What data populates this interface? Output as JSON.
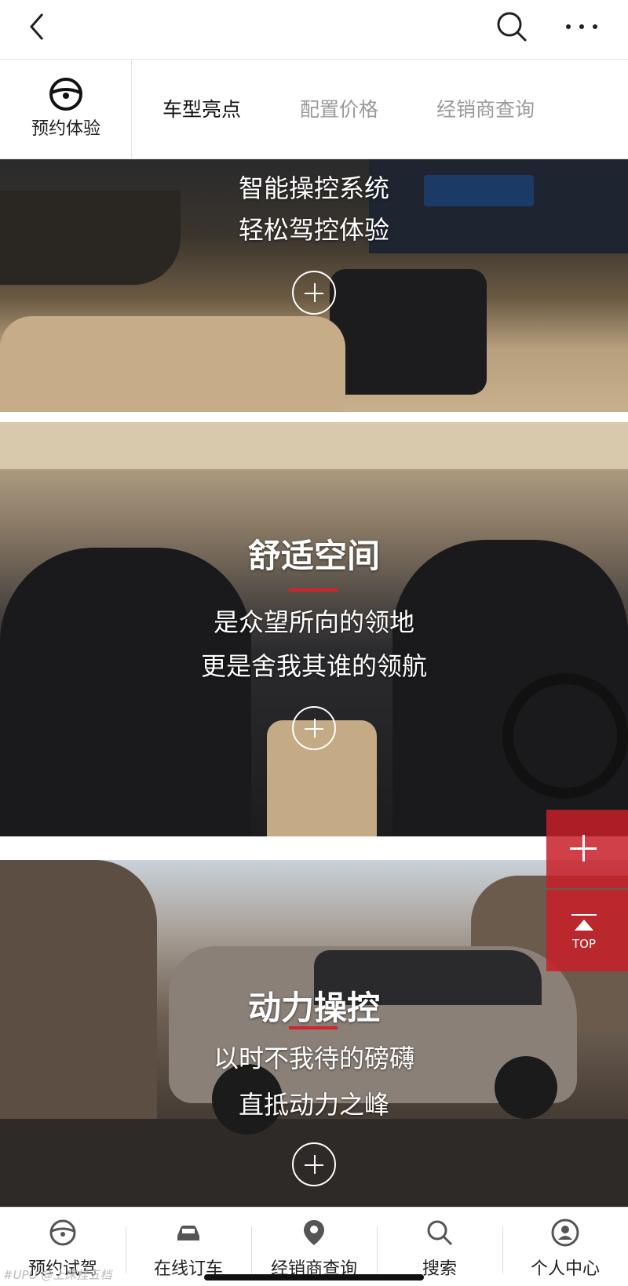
{
  "subnav": {
    "book_label": "预约体验",
    "tabs": [
      {
        "label": "车型亮点",
        "active": true
      },
      {
        "label": "配置价格",
        "active": false
      },
      {
        "label": "经销商查询",
        "active": false
      }
    ]
  },
  "panels": [
    {
      "lines": [
        "智能操控系统",
        "轻松驾控体验"
      ]
    },
    {
      "title": "舒适空间",
      "lines": [
        "是众望所向的领地",
        "更是舍我其谁的领航"
      ]
    },
    {
      "title": "动力操控",
      "lines": [
        "以时不我待的磅礴",
        "直抵动力之峰"
      ]
    }
  ],
  "fab": {
    "top_label": "TOP"
  },
  "bottom_nav": [
    {
      "label": "预约试驾",
      "icon": "steering-wheel-icon"
    },
    {
      "label": "在线订车",
      "icon": "car-icon"
    },
    {
      "label": "经销商查询",
      "icon": "location-pin-icon"
    },
    {
      "label": "搜索",
      "icon": "search-icon"
    },
    {
      "label": "个人中心",
      "icon": "user-icon"
    }
  ],
  "watermark": "#UPU @上床挂五档",
  "colors": {
    "accent": "#d2232a",
    "active_tab": "#111111",
    "inactive_tab": "#9a9a9a"
  }
}
